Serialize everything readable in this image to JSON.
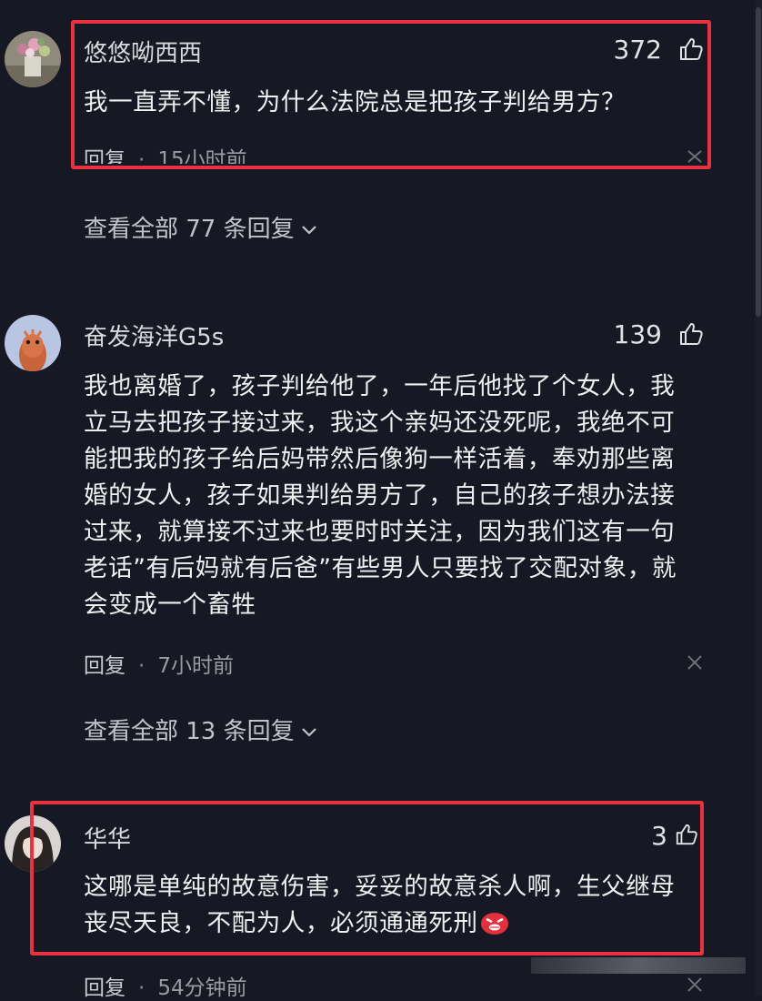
{
  "comments": [
    {
      "username": "悠悠呦西西",
      "likes": "372",
      "lines": [
        "我一直弄不懂，为什么法院总是把孩子判给男方？"
      ],
      "reply_label": "回复",
      "time": "15小时前",
      "view_all": "查看全部 77 条回复"
    },
    {
      "username": "奋发海洋G5s",
      "likes": "139",
      "lines": [
        "我也离婚了，孩子判给他了，一年后他找了个女人，我",
        "立马去把孩子接过来，我这个亲妈还没死呢，我绝不可",
        "能把我的孩子给后妈带然后像狗一样活着，奉劝那些离",
        "婚的女人，孩子如果判给男方了，自己的孩子想办法接",
        "过来，就算接不过来也要时时关注，因为我们这有一句",
        "老话”有后妈就有后爸”有些男人只要找了交配对象，就",
        "会变成一个畜牲"
      ],
      "reply_label": "回复",
      "time": "7小时前",
      "view_all": "查看全部 13 条回复"
    },
    {
      "username": "华华",
      "likes": "3",
      "lines": [
        "这哪是单纯的故意伤害，妥妥的故意杀人啊，生父继母",
        "丧尽天良，不配为人，必须通通死刑"
      ],
      "reply_label": "回复",
      "time": "54分钟前"
    }
  ],
  "icons": {
    "like": "thumbs-up-icon",
    "close": "close-icon",
    "chevron": "chevron-down-icon",
    "emoji": "angry-face-emoji"
  },
  "colors": {
    "background": "#161823",
    "highlight": "#e8323f",
    "text": "#f0f0f2",
    "muted": "#9a9aa2"
  }
}
